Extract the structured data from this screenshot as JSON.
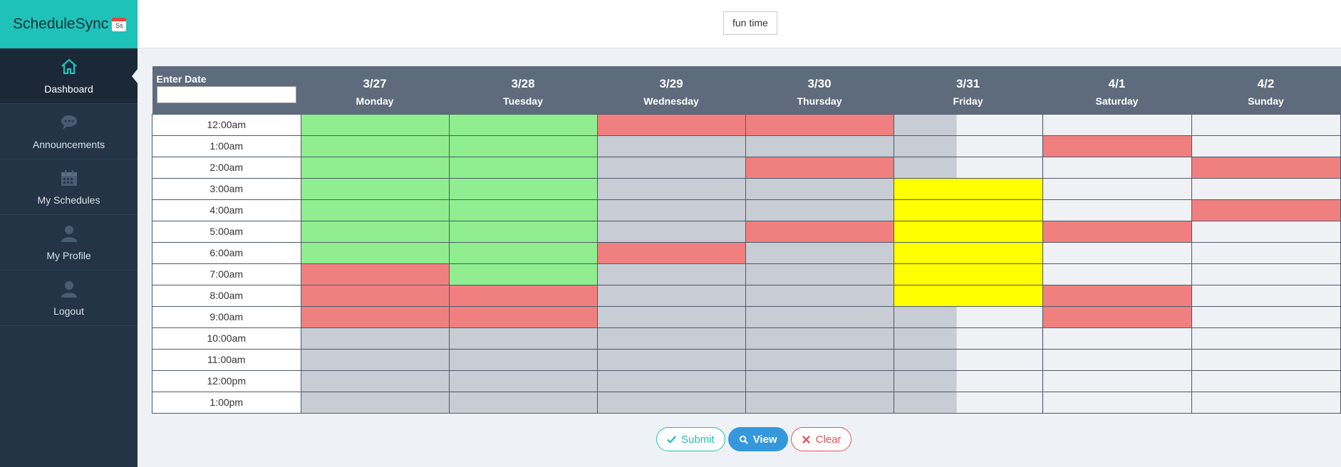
{
  "app": {
    "brand": "ScheduleSync",
    "brand_icon_text": "Ss",
    "schedule_title": "fun time"
  },
  "sidebar": {
    "items": [
      {
        "label": "Dashboard",
        "icon": "home-icon",
        "active": true
      },
      {
        "label": "Announcements",
        "icon": "chat-bubble-icon"
      },
      {
        "label": "My Schedules",
        "icon": "calendar-icon"
      },
      {
        "label": "My Profile",
        "icon": "user-icon"
      },
      {
        "label": "Logout",
        "icon": "user-icon"
      }
    ]
  },
  "grid": {
    "date_label": "Enter Date",
    "date_value": "",
    "columns": [
      {
        "date": "3/27",
        "day": "Monday"
      },
      {
        "date": "3/28",
        "day": "Tuesday"
      },
      {
        "date": "3/29",
        "day": "Wednesday"
      },
      {
        "date": "3/30",
        "day": "Thursday"
      },
      {
        "date": "3/31",
        "day": "Friday"
      },
      {
        "date": "4/1",
        "day": "Saturday"
      },
      {
        "date": "4/2",
        "day": "Sunday"
      }
    ],
    "legend_colors": {
      "available": "#90ee90",
      "busy": "#f08080",
      "selected": "#ffff00",
      "disabled": "#c8ccd4",
      "empty": "#eff1f5"
    },
    "rows": [
      {
        "time": "12:00am",
        "cells": [
          "g",
          "g",
          "r",
          "r",
          "half",
          "w",
          "w"
        ]
      },
      {
        "time": "1:00am",
        "cells": [
          "g",
          "g",
          "x",
          "x",
          "half",
          "r",
          "w"
        ]
      },
      {
        "time": "2:00am",
        "cells": [
          "g",
          "g",
          "x",
          "r",
          "half",
          "w",
          "r"
        ]
      },
      {
        "time": "3:00am",
        "cells": [
          "g",
          "g",
          "x",
          "x",
          "y",
          "w",
          "w"
        ]
      },
      {
        "time": "4:00am",
        "cells": [
          "g",
          "g",
          "x",
          "x",
          "y",
          "w",
          "r"
        ]
      },
      {
        "time": "5:00am",
        "cells": [
          "g",
          "g",
          "x",
          "r",
          "y",
          "r",
          "w"
        ]
      },
      {
        "time": "6:00am",
        "cells": [
          "g",
          "g",
          "r",
          "x",
          "y",
          "w",
          "w"
        ]
      },
      {
        "time": "7:00am",
        "cells": [
          "r",
          "g",
          "x",
          "x",
          "y",
          "w",
          "w"
        ]
      },
      {
        "time": "8:00am",
        "cells": [
          "r",
          "r",
          "x",
          "x",
          "y",
          "r",
          "w"
        ]
      },
      {
        "time": "9:00am",
        "cells": [
          "r",
          "r",
          "x",
          "x",
          "half",
          "r",
          "w"
        ]
      },
      {
        "time": "10:00am",
        "cells": [
          "x",
          "x",
          "x",
          "x",
          "half",
          "w",
          "w"
        ]
      },
      {
        "time": "11:00am",
        "cells": [
          "x",
          "x",
          "x",
          "x",
          "half",
          "w",
          "w"
        ]
      },
      {
        "time": "12:00pm",
        "cells": [
          "x",
          "x",
          "x",
          "x",
          "half",
          "w",
          "w"
        ]
      },
      {
        "time": "1:00pm",
        "cells": [
          "x",
          "x",
          "x",
          "x",
          "half",
          "w",
          "w"
        ]
      }
    ]
  },
  "actions": {
    "submit": "Submit",
    "view": "View",
    "clear": "Clear"
  }
}
